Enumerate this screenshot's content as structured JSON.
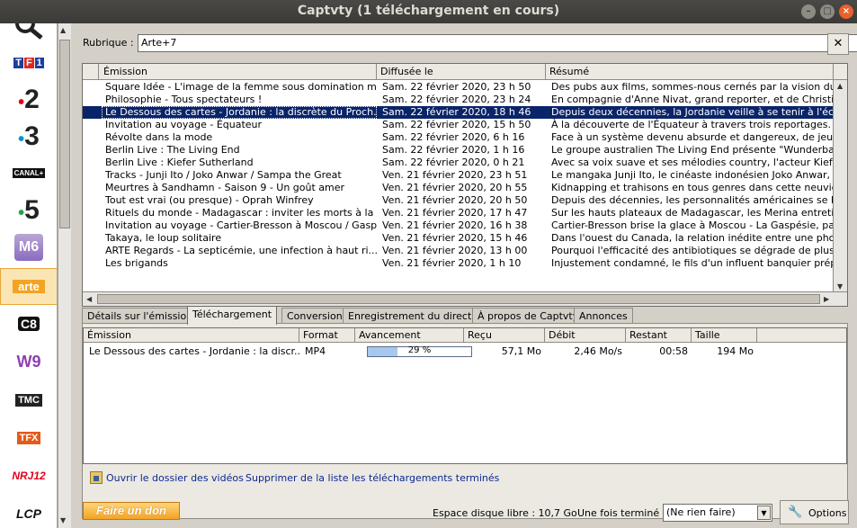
{
  "window": {
    "title": "Captvty (1 téléchargement en cours)"
  },
  "channels": [
    {
      "id": "search",
      "label": ""
    },
    {
      "id": "tf1",
      "label": "TF1"
    },
    {
      "id": "france2",
      "label": "2"
    },
    {
      "id": "france3",
      "label": "3"
    },
    {
      "id": "canalplus",
      "label": "CANAL+"
    },
    {
      "id": "france5",
      "label": "5"
    },
    {
      "id": "m6",
      "label": "M6"
    },
    {
      "id": "arte",
      "label": "arte",
      "selected": true
    },
    {
      "id": "c8",
      "label": "C8"
    },
    {
      "id": "w9",
      "label": "W9"
    },
    {
      "id": "tmc",
      "label": "TMC"
    },
    {
      "id": "tfx",
      "label": "TFX"
    },
    {
      "id": "nrj12",
      "label": "NRJ12"
    },
    {
      "id": "lcp",
      "label": "LCP"
    }
  ],
  "rubrique": {
    "label": "Rubrique :",
    "value": "Arte+7"
  },
  "emissions": {
    "headers": [
      "Émission",
      "Diffusée le",
      "Résumé"
    ],
    "rows": [
      {
        "emission": "Square Idée - L'image de la femme sous domination m...",
        "date": "Sam. 22 février 2020, 23 h 50",
        "resume": "Des pubs aux films, sommes-nous cernés par la vision du \"mâ"
      },
      {
        "emission": "Philosophie - Tous spectateurs !",
        "date": "Sam. 22 février 2020, 23 h 24",
        "resume": "En compagnie d'Anne Nivat, grand reporter, et de Christian"
      },
      {
        "emission": "Le Dessous des cartes - Jordanie : la discrète du Proch...",
        "date": "Sam. 22 février 2020, 18 h 46",
        "resume": "Depuis deux décennies, la Jordanie veille à se tenir à l'écar",
        "selected": true
      },
      {
        "emission": "Invitation au voyage - Équateur",
        "date": "Sam. 22 février 2020, 15 h 50",
        "resume": "À la découverte de l'Équateur à travers trois reportages."
      },
      {
        "emission": "Révolte dans la mode",
        "date": "Sam. 22 février 2020, 6 h 16",
        "resume": "Face à un système devenu absurde et dangereux, de jeune"
      },
      {
        "emission": "Berlin Live : The Living End",
        "date": "Sam. 22 février 2020, 1 h 16",
        "resume": "Le groupe australien The Living End présente \"Wunderbar\""
      },
      {
        "emission": "Berlin Live : Kiefer Sutherland",
        "date": "Sam. 22 février 2020, 0 h 21",
        "resume": "Avec sa voix suave et ses mélodies country, l'acteur Kiefer S"
      },
      {
        "emission": "Tracks - Junji Ito / Joko Anwar / Sampa the Great",
        "date": "Ven. 21 février 2020, 23 h 51",
        "resume": "Le mangaka Junji Ito, le cinéaste indonésien Joko Anwar, le"
      },
      {
        "emission": "Meurtres à Sandhamn - Saison 9 - Un goût amer",
        "date": "Ven. 21 février 2020, 20 h 55",
        "resume": "Kidnapping et trahisons en tous genres dans cette neuvièm"
      },
      {
        "emission": "Tout est vrai (ou presque) - Oprah Winfrey",
        "date": "Ven. 21 février 2020, 20 h 50",
        "resume": "Depuis des décennies, les personnalités américaines se bou"
      },
      {
        "emission": "Rituels du monde - Madagascar : inviter les morts à la ...",
        "date": "Ven. 21 février 2020, 17 h 47",
        "resume": "Sur les hauts plateaux de Madagascar, les Merina entretien"
      },
      {
        "emission": "Invitation au voyage - Cartier-Bresson à Moscou / Gasp...",
        "date": "Ven. 21 février 2020, 16 h 38",
        "resume": "Cartier-Bresson brise la glace à Moscou - La Gaspésie, pays"
      },
      {
        "emission": "Takaya, le loup solitaire",
        "date": "Ven. 21 février 2020, 15 h 46",
        "resume": "Dans l'ouest du Canada, la relation inédite entre une photo"
      },
      {
        "emission": "ARTE Regards - La septicémie, une infection à haut ri...",
        "date": "Ven. 21 février 2020, 13 h 00",
        "resume": "Pourquoi l'efficacité des antibiotiques se dégrade de plus e"
      },
      {
        "emission": "Les brigands",
        "date": "Ven. 21 février 2020, 1 h 10",
        "resume": "Injustement condamné, le fils d'un influent banquier prépa"
      }
    ]
  },
  "tabs": [
    {
      "label": "Détails sur l'émission"
    },
    {
      "label": "Téléchargement",
      "active": true
    },
    {
      "label": "Conversion"
    },
    {
      "label": "Enregistrement du direct"
    },
    {
      "label": "À propos de Captvty"
    },
    {
      "label": "Annonces"
    }
  ],
  "downloads": {
    "headers": [
      "Émission",
      "Format",
      "Avancement",
      "Reçu",
      "Débit",
      "Restant",
      "Taille"
    ],
    "rows": [
      {
        "emission": "Le Dessous des cartes - Jordanie : la discr...",
        "format": "MP4",
        "progress": 29,
        "progress_label": "29 %",
        "recu": "57,1 Mo",
        "debit": "2,46 Mo/s",
        "restant": "00:58",
        "taille": "194 Mo"
      }
    ]
  },
  "links": {
    "open_folder": "Ouvrir le dossier des vidéos",
    "clear_list": "Supprimer de la liste les téléchargements terminés"
  },
  "bottom": {
    "donate": "Faire un don",
    "disk_space": "Espace disque libre : 10,7 Go",
    "after_label": "Une fois terminé :",
    "after_value": "(Ne rien faire)",
    "options": "Options"
  },
  "colors": {
    "selection": "#0a246a",
    "arte_accent": "#f4a322",
    "link": "#0a2896"
  }
}
